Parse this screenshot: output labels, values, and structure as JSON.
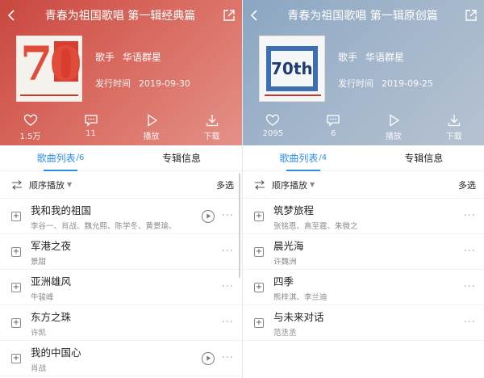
{
  "left": {
    "title": "青春为祖国歌唱 第一辑经典篇",
    "cover_text": "70",
    "singer_key": "歌手",
    "singer": "华语群星",
    "release_key": "发行时间",
    "release_date": "2019-09-30",
    "actions": [
      {
        "icon": "heart-icon",
        "label": "1.5万"
      },
      {
        "icon": "comment-icon",
        "label": "11"
      },
      {
        "icon": "play-icon",
        "label": "播放"
      },
      {
        "icon": "download-icon",
        "label": "下载"
      }
    ],
    "tabs": [
      {
        "label": "歌曲列表",
        "count": "/6"
      },
      {
        "label": "专辑信息",
        "count": ""
      }
    ],
    "order_label": "顺序播放",
    "multi_label": "多选",
    "songs": [
      {
        "name": "我和我的祖国",
        "artist": "李谷一、肖战、魏允熙、陈学冬、黄景瑜、",
        "mv": true
      },
      {
        "name": "军港之夜",
        "artist": "景甜",
        "mv": false
      },
      {
        "name": "亚洲雄风",
        "artist": "牛骏峰",
        "mv": false
      },
      {
        "name": "东方之珠",
        "artist": "许凯",
        "mv": false
      },
      {
        "name": "我的中国心",
        "artist": "肖战",
        "mv": true
      }
    ]
  },
  "right": {
    "title": "青春为祖国歌唱 第一辑原创篇",
    "cover_text": "70th",
    "singer_key": "歌手",
    "singer": "华语群星",
    "release_key": "发行时间",
    "release_date": "2019-09-25",
    "actions": [
      {
        "icon": "heart-icon",
        "label": "2095"
      },
      {
        "icon": "comment-icon",
        "label": "6"
      },
      {
        "icon": "play-icon",
        "label": "播放"
      },
      {
        "icon": "download-icon",
        "label": "下载"
      }
    ],
    "tabs": [
      {
        "label": "歌曲列表",
        "count": "/4"
      },
      {
        "label": "专辑信息",
        "count": ""
      }
    ],
    "order_label": "顺序播放",
    "multi_label": "多选",
    "songs": [
      {
        "name": "筑梦旅程",
        "artist": "张铭恩、高至霆、朱微之",
        "mv": false
      },
      {
        "name": "晨光海",
        "artist": "许魏洲",
        "mv": false
      },
      {
        "name": "四季",
        "artist": "熊梓淇、李兰迪",
        "mv": false
      },
      {
        "name": "与未来对话",
        "artist": "范丞丞",
        "mv": false
      }
    ]
  }
}
